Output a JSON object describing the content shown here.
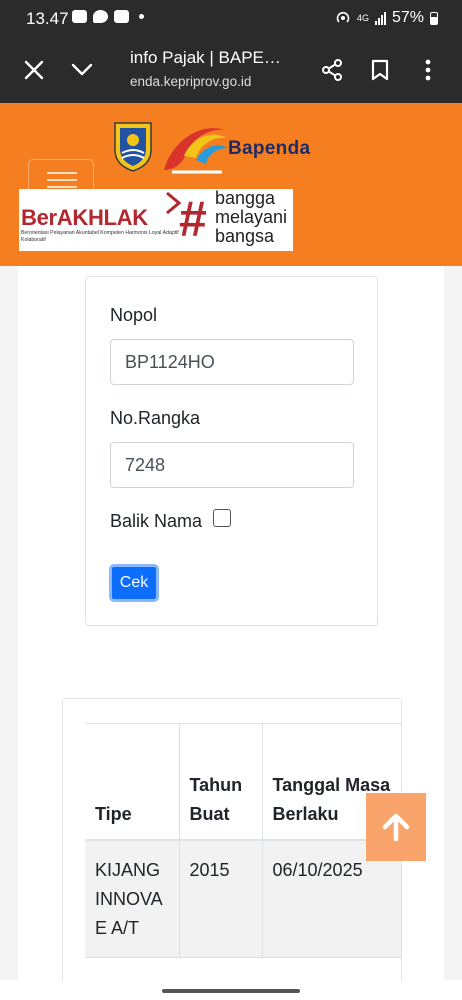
{
  "status_bar": {
    "time": "13.47",
    "network": "4G",
    "battery": "57%",
    "icons": [
      "phone-link-icon",
      "chat-icon",
      "image-icon",
      "dot-icon",
      "hotspot-icon",
      "signal-icon",
      "battery-icon"
    ]
  },
  "browser": {
    "title": "info Pajak | BAPE…",
    "url": "enda.kepriprov.go.id",
    "icons": [
      "close-icon",
      "chevron-down-icon",
      "share-icon",
      "bookmark-icon",
      "more-vert-icon"
    ]
  },
  "header": {
    "brand": "Bapenda",
    "banner": {
      "main": "BerAKHLAK",
      "sub": "Berorientasi Pelayanan Akuntabel Kompeten Harmonis Loyal Adaptif Kolaboratif",
      "hash": "#",
      "slogan": [
        "bangga",
        "melayani",
        "bangsa"
      ]
    },
    "colors": {
      "header_bg": "#f57f20",
      "accent": "#b3272e"
    }
  },
  "form": {
    "nopol_label": "Nopol",
    "nopol_value": "BP1124HO",
    "rangka_label": "No.Rangka",
    "rangka_value": "7248",
    "balik_nama_label": "Balik Nama",
    "balik_nama_checked": false,
    "submit_label": "Cek"
  },
  "result_table": {
    "headers": [
      "Tipe",
      "Tahun Buat",
      "Tanggal Masa Berlaku"
    ],
    "rows": [
      [
        "KIJANG INNOVA E A/T",
        "2015",
        "06/10/2025"
      ]
    ]
  },
  "scroll_top": {
    "icon": "arrow-up-icon"
  }
}
